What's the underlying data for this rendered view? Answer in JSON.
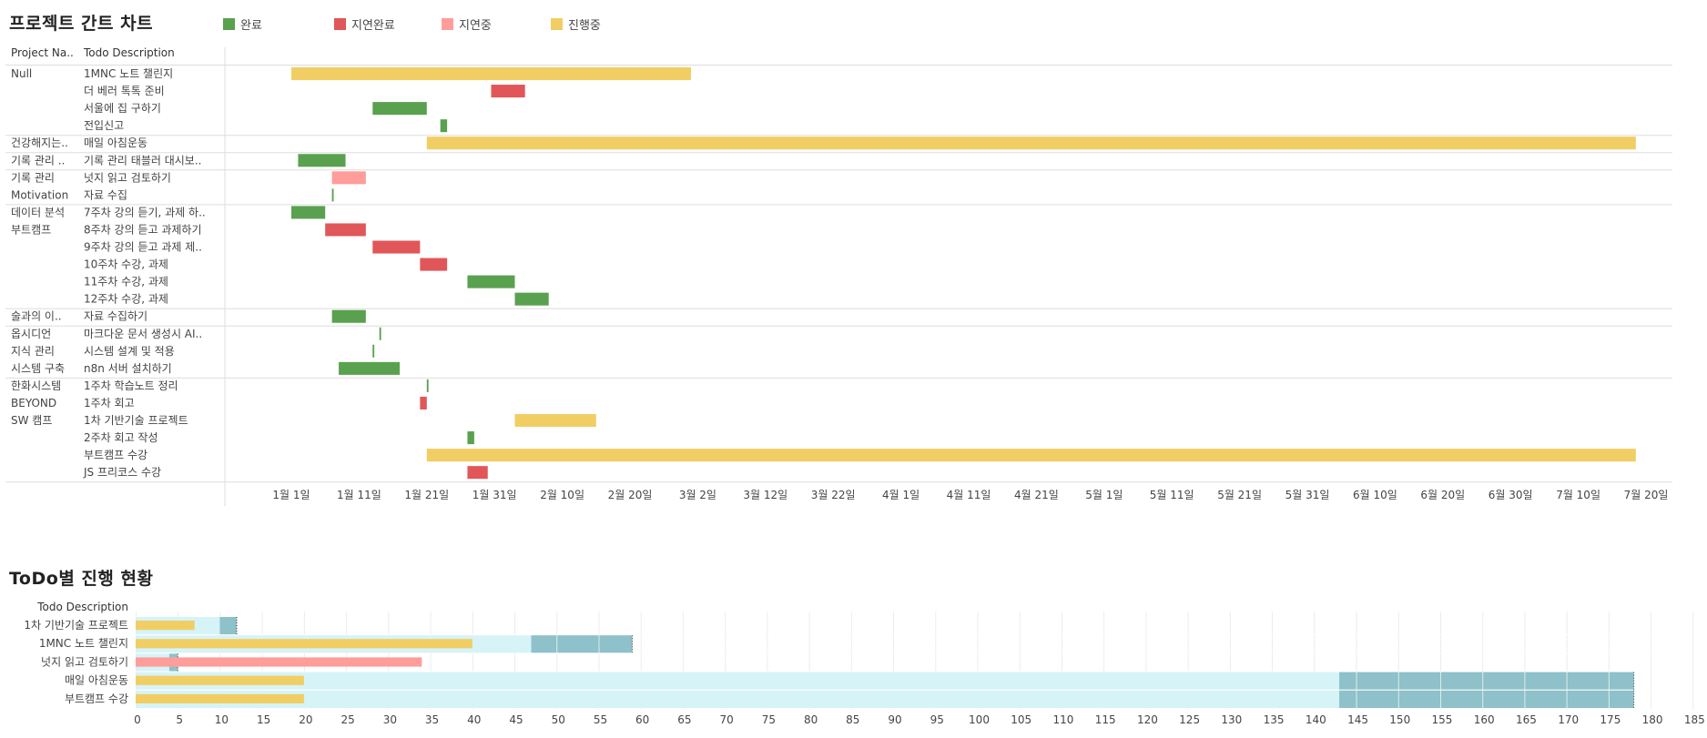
{
  "gantt": {
    "title": "프로젝트 간트 차트",
    "legend": [
      {
        "label": "완료",
        "color": "#59a14f"
      },
      {
        "label": "지연완료",
        "color": "#e15759"
      },
      {
        "label": "지연중",
        "color": "#ff9d9a"
      },
      {
        "label": "진행중",
        "color": "#f1ce63"
      }
    ],
    "col_project_header": "Project Na..",
    "col_todo_header": "Todo Description"
  },
  "progress": {
    "title": "ToDo별 진행 현황",
    "row_header": "Todo Description"
  },
  "chart_data": [
    {
      "type": "gantt",
      "title": "프로젝트 간트 차트",
      "x_tick_labels": [
        "1월 1일",
        "1월 11일",
        "1월 21일",
        "1월 31일",
        "2월 10일",
        "2월 20일",
        "3월 2일",
        "3월 12일",
        "3월 22일",
        "4월 1일",
        "4월 11일",
        "4월 21일",
        "5월 1일",
        "5월 11일",
        "5월 21일",
        "5월 31일",
        "6월 10일",
        "6월 20일",
        "6월 30일",
        "7월 10일",
        "7월 20일"
      ],
      "x_tick_days": [
        0,
        10,
        20,
        30,
        40,
        50,
        60,
        70,
        80,
        90,
        100,
        110,
        120,
        130,
        140,
        150,
        160,
        170,
        180,
        190,
        200
      ],
      "x_range_days": [
        -9.5,
        212
      ],
      "groups": [
        {
          "label": "Null",
          "tasks": [
            {
              "todo": "1MNC 노트 챌린지",
              "start": 0,
              "end": 59,
              "status": "진행중"
            },
            {
              "todo": "더 베러 톡톡 준비",
              "start": 29.5,
              "end": 34.5,
              "status": "지연완료"
            },
            {
              "todo": "서울에 집 구하기",
              "start": 12,
              "end": 20,
              "status": "완료"
            },
            {
              "todo": "전입신고",
              "start": 22,
              "end": 23,
              "status": "완료"
            }
          ]
        },
        {
          "label": "건강해지는..",
          "tasks": [
            {
              "todo": "매일 아침운동",
              "start": 20,
              "end": 198.5,
              "status": "진행중"
            }
          ]
        },
        {
          "label": "기록 관리 ..",
          "tasks": [
            {
              "todo": "기록 관리 태블러 대시보..",
              "start": 1,
              "end": 8,
              "status": "완료"
            }
          ]
        },
        {
          "label": "기록 관리\nMotivation",
          "tasks": [
            {
              "todo": "넛지 읽고 검토하기",
              "start": 6,
              "end": 11,
              "status": "지연중"
            },
            {
              "todo": "자료 수집",
              "start": 6,
              "end": 6.25,
              "status": "완료"
            }
          ]
        },
        {
          "label": "데이터 분석\n부트캠프",
          "tasks": [
            {
              "todo": "7주차 강의 듣기, 과제 하..",
              "start": 0,
              "end": 5,
              "status": "완료"
            },
            {
              "todo": "8주차 강의 듣고 과제하기",
              "start": 5,
              "end": 11,
              "status": "지연완료"
            },
            {
              "todo": "9주차 강의 듣고 과제 제..",
              "start": 12,
              "end": 19,
              "status": "지연완료"
            },
            {
              "todo": "10주차 수강, 과제",
              "start": 19,
              "end": 23,
              "status": "지연완료"
            },
            {
              "todo": "11주차 수강, 과제",
              "start": 26,
              "end": 33,
              "status": "완료"
            },
            {
              "todo": "12주차 수강, 과제",
              "start": 33,
              "end": 38,
              "status": "완료"
            }
          ]
        },
        {
          "label": "술과의 이..",
          "tasks": [
            {
              "todo": "자료 수집하기",
              "start": 6,
              "end": 11,
              "status": "완료"
            }
          ]
        },
        {
          "label": "옵시디언\n지식 관리\n시스템 구축",
          "tasks": [
            {
              "todo": "마크다운 문서 생성시 AI..",
              "start": 13,
              "end": 13.25,
              "status": "완료"
            },
            {
              "todo": "시스템 설계 및 적용",
              "start": 12,
              "end": 12.25,
              "status": "완료"
            },
            {
              "todo": "n8n 서버 설치하기",
              "start": 7,
              "end": 16,
              "status": "완료"
            }
          ]
        },
        {
          "label": "한화시스템\nBEYOND\nSW 캠프",
          "tasks": [
            {
              "todo": "1주차 학습노트 정리",
              "start": 20,
              "end": 20.25,
              "status": "완료"
            },
            {
              "todo": "1주차 회고",
              "start": 19,
              "end": 20,
              "status": "지연완료"
            },
            {
              "todo": "1차 기반기술 프로젝트",
              "start": 33,
              "end": 45,
              "status": "진행중"
            },
            {
              "todo": "2주차 회고 작성",
              "start": 26,
              "end": 27,
              "status": "완료"
            },
            {
              "todo": "부트캠프 수강",
              "start": 20,
              "end": 198.5,
              "status": "진행중"
            },
            {
              "todo": "JS 프리코스 수강",
              "start": 26,
              "end": 29,
              "status": "지연완료"
            }
          ]
        }
      ]
    },
    {
      "type": "bar",
      "title": "ToDo별 진행 현황",
      "orientation": "horizontal",
      "x_range": [
        0,
        185
      ],
      "x_ticks": [
        0,
        5,
        10,
        15,
        20,
        25,
        30,
        35,
        40,
        45,
        50,
        55,
        60,
        65,
        70,
        75,
        80,
        85,
        90,
        95,
        100,
        105,
        110,
        115,
        120,
        125,
        130,
        135,
        140,
        145,
        150,
        155,
        160,
        165,
        170,
        175,
        180,
        185
      ],
      "categories": [
        "1차 기반기술 프로젝트",
        "1MNC 노트 챌린지",
        "넛지 읽고 검토하기",
        "매일 아침운동",
        "부트캠프 수강"
      ],
      "elapsed": [
        7,
        40,
        34,
        20,
        20
      ],
      "elapsed_status": [
        "진행중",
        "진행중",
        "지연중",
        "진행중",
        "진행중"
      ],
      "planned_total": [
        12,
        59,
        5,
        178,
        178
      ],
      "band_start": [
        10,
        47,
        4,
        143,
        143
      ]
    }
  ]
}
